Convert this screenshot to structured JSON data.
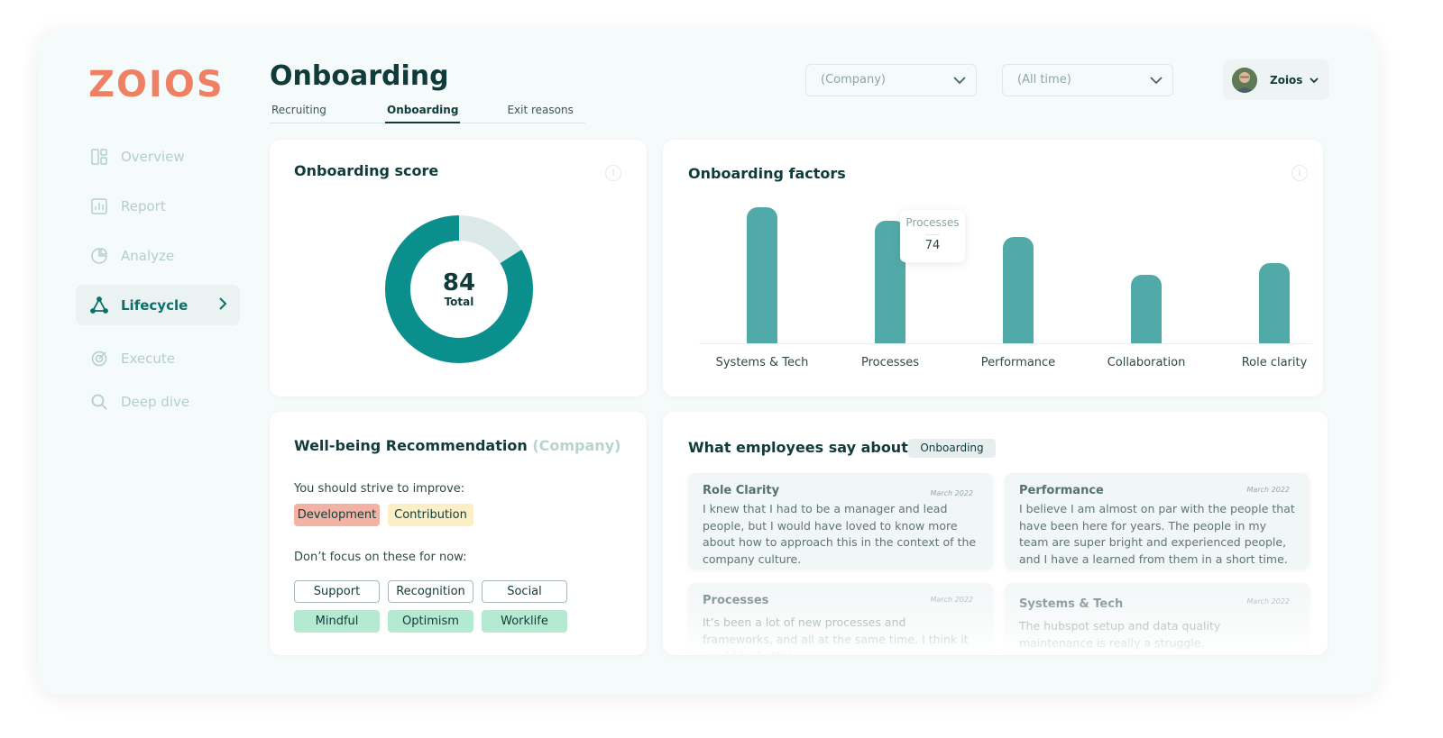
{
  "brand": {
    "logo_text": "ZOIOS",
    "color": "#ee8063"
  },
  "sidebar": {
    "items": [
      {
        "label": "Overview",
        "icon": "overview-icon"
      },
      {
        "label": "Report",
        "icon": "report-icon"
      },
      {
        "label": "Analyze",
        "icon": "analyze-icon"
      },
      {
        "label": "Lifecycle",
        "icon": "lifecycle-icon",
        "active": true
      },
      {
        "label": "Execute",
        "icon": "execute-icon"
      },
      {
        "label": "Deep dive",
        "icon": "search-icon"
      }
    ]
  },
  "header": {
    "title": "Onboarding",
    "tabs": [
      {
        "label": "Recruiting"
      },
      {
        "label": "Onboarding",
        "active": true
      },
      {
        "label": "Exit reasons"
      }
    ],
    "company_select": {
      "value": "(Company)"
    },
    "time_select": {
      "value": "(All time)"
    },
    "user": {
      "name": "Zoios"
    }
  },
  "score_card": {
    "title": "Onboarding score",
    "value": "84",
    "label": "Total",
    "percent": 84,
    "colors": {
      "fill": "#0b8f8c",
      "rest": "#dbe9e8"
    }
  },
  "factors_card": {
    "title": "Onboarding factors",
    "tooltip": {
      "name": "Processes",
      "value": "74"
    },
    "chart_data": {
      "type": "bar",
      "categories": [
        "Systems & Tech",
        "Processes",
        "Performance",
        "Collaboration",
        "Role clarity"
      ],
      "values": [
        82,
        74,
        64,
        41,
        48
      ],
      "ylim": [
        0,
        90
      ],
      "color": "#51aaa8"
    }
  },
  "wellbeing_card": {
    "title": "Well-being Recommendation",
    "title_suffix": "(Company)",
    "improve_label": "You should strive to improve:",
    "improve": [
      "Development",
      "Contribution"
    ],
    "nofocus_label": "Don’t focus on these for now:",
    "nofocus": [
      "Support",
      "Recognition",
      "Social"
    ],
    "strengths": [
      "Mindful",
      "Optimism",
      "Worklife"
    ]
  },
  "employees_card": {
    "title": "What employees say about",
    "badge": "Onboarding",
    "quotes": [
      {
        "title": "Role Clarity",
        "date": "March 2022",
        "text": "I knew that I had to be a manager and lead people, but I would have loved to know more about how to approach this in the context of the company culture."
      },
      {
        "title": "Performance",
        "date": "March 2022",
        "text": "I believe I am almost on par with the people that have been here for years. The people in my team are super bright and experienced people, and I have a learned from them in a short time."
      },
      {
        "title": "Processes",
        "date": "March 2022",
        "text": "It’s been a lot of new processes and frameworks, and all at the same time. I think it would be better"
      },
      {
        "title": "Systems & Tech",
        "date": "March 2022",
        "text": "The hubspot setup and data quality maintenance is really a struggle."
      }
    ]
  }
}
